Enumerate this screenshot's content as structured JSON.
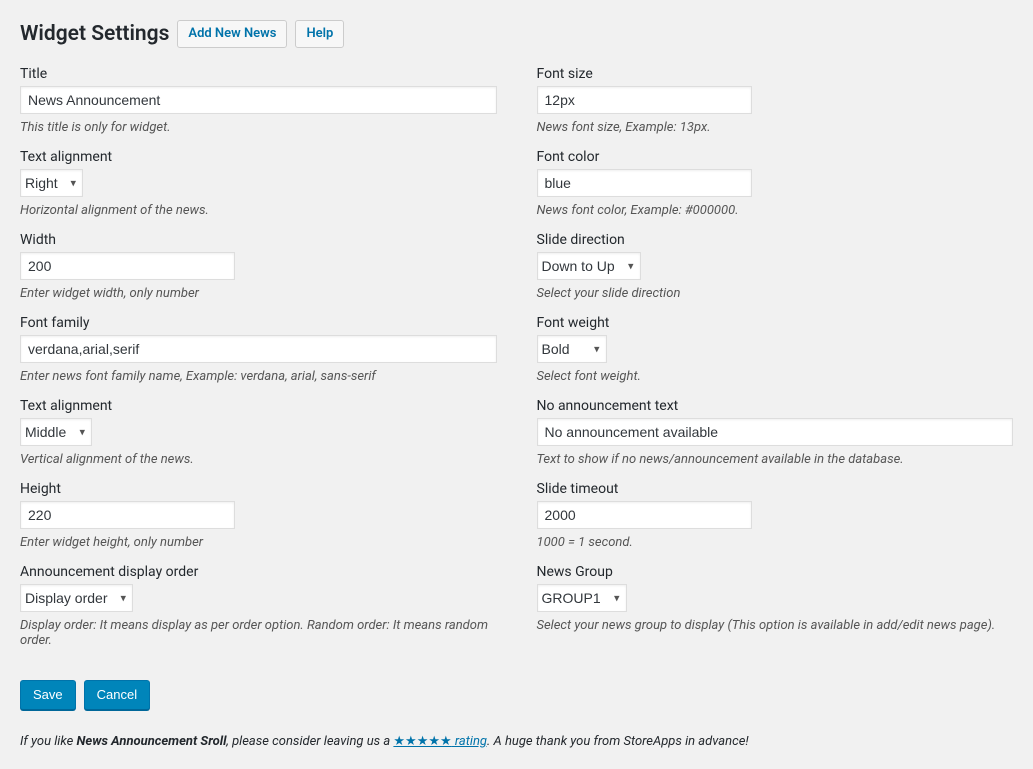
{
  "header": {
    "title": "Widget Settings",
    "add_button": "Add New News",
    "help_button": "Help"
  },
  "left": {
    "title": {
      "label": "Title",
      "value": "News Announcement",
      "hint": "This title is only for widget."
    },
    "halign": {
      "label": "Text alignment",
      "value": "Right",
      "hint": "Horizontal alignment of the news."
    },
    "width": {
      "label": "Width",
      "value": "200",
      "hint": "Enter widget width, only number"
    },
    "fontfam": {
      "label": "Font family",
      "value": "verdana,arial,serif",
      "hint": "Enter news font family name, Example: verdana, arial, sans-serif"
    },
    "valign": {
      "label": "Text alignment",
      "value": "Middle",
      "hint": "Vertical alignment of the news."
    },
    "height": {
      "label": "Height",
      "value": "220",
      "hint": "Enter widget height, only number"
    },
    "disporder": {
      "label": "Announcement display order",
      "value": "Display order",
      "hint": "Display order: It means display as per order option. Random order: It means random order."
    }
  },
  "right": {
    "fontsize": {
      "label": "Font size",
      "value": "12px",
      "hint": "News font size, Example: 13px."
    },
    "fontcolor": {
      "label": "Font color",
      "value": "blue",
      "hint": "News font color, Example: #000000."
    },
    "slidedir": {
      "label": "Slide direction",
      "value": "Down to Up",
      "hint": "Select your slide direction"
    },
    "fontweight": {
      "label": "Font weight",
      "value": "Bold",
      "hint": "Select font weight."
    },
    "noann": {
      "label": "No announcement text",
      "value": "No announcement available",
      "hint": "Text to show if no news/announcement available in the database."
    },
    "timeout": {
      "label": "Slide timeout",
      "value": "2000",
      "hint": "1000 = 1 second."
    },
    "group": {
      "label": "News Group",
      "value": "GROUP1",
      "hint": "Select your news group to display (This option is available in add/edit news page)."
    }
  },
  "actions": {
    "save": "Save",
    "cancel": "Cancel"
  },
  "footer": {
    "pre": "If you like ",
    "product": "News Announcement Sroll",
    "mid": ", please consider leaving us a ",
    "stars": "★★★★★",
    "rating_word": " rating",
    "post": ". A huge thank you from StoreApps in advance!"
  }
}
